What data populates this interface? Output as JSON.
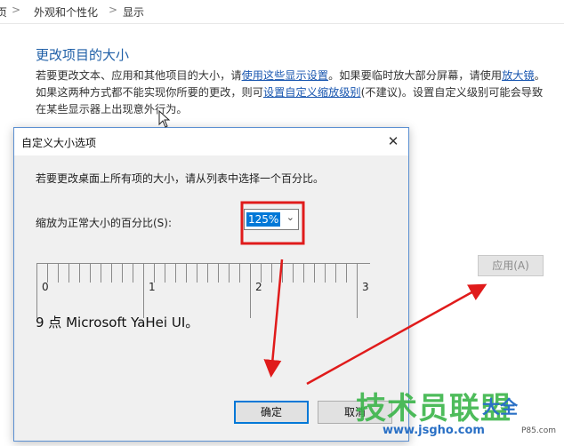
{
  "breadcrumb": {
    "partial": "页",
    "items": [
      "外观和个性化",
      "显示"
    ],
    "separator": ">"
  },
  "section": {
    "title": "更改项目的大小",
    "desc_1": "若要更改文本、应用和其他项目的大小，请",
    "link_1": "使用这些显示设置",
    "desc_2": "。如果要临时放大部分屏幕，请使用",
    "link_2": "放大镜",
    "desc_3": "。如果这两种方式都不能实现你所要的更改，则可",
    "link_3": "设置自定义缩放级别",
    "desc_4": "(不建议)。设置自定义级别可能会导致在某些显示器上出现意外行为。"
  },
  "apply_button": "应用(A)",
  "dialog": {
    "title": "自定义大小选项",
    "close_glyph": "✕",
    "instruction": "若要更改桌面上所有项的大小，请从列表中选择一个百分比。",
    "scale_label": "缩放为正常大小的百分比(S):",
    "scale_value": "125%",
    "ruler_labels": [
      "0",
      "1",
      "2",
      "3"
    ],
    "sample_text": "9 点 Microsoft YaHei UI。",
    "ok_button": "确定",
    "cancel_button": "取消"
  },
  "watermark": {
    "main": "技术员联盟",
    "sub": "大全",
    "url": "www.jsgho.com",
    "url2": "P85.com"
  },
  "colors": {
    "highlight": "#e01b1b",
    "link": "#1a57b0",
    "accent": "#0078d7"
  },
  "icons": [
    "chevron-down-icon",
    "close-icon",
    "mouse-cursor-icon",
    "chevron-right-icon"
  ]
}
